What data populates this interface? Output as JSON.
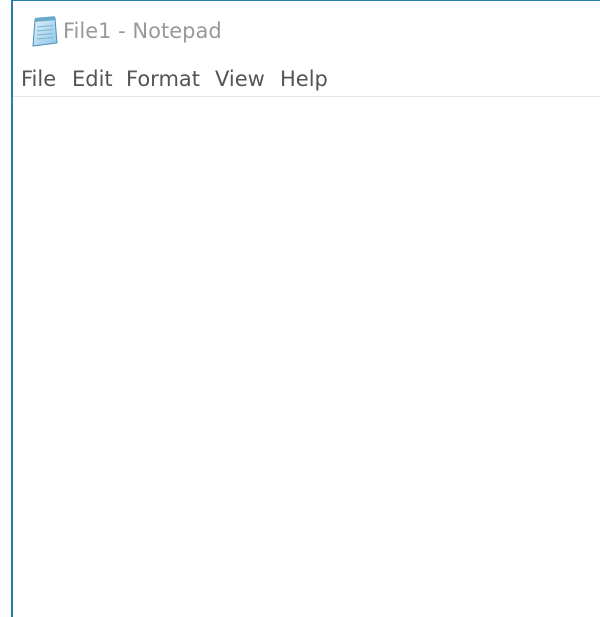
{
  "window": {
    "title": "File1 - Notepad",
    "accent_color": "#2a7bb0",
    "icon": "notepad-icon"
  },
  "menu": {
    "items": [
      {
        "label": "File"
      },
      {
        "label": "Edit"
      },
      {
        "label": "Format"
      },
      {
        "label": "View"
      },
      {
        "label": "Help"
      }
    ]
  },
  "editor": {
    "content": ""
  }
}
